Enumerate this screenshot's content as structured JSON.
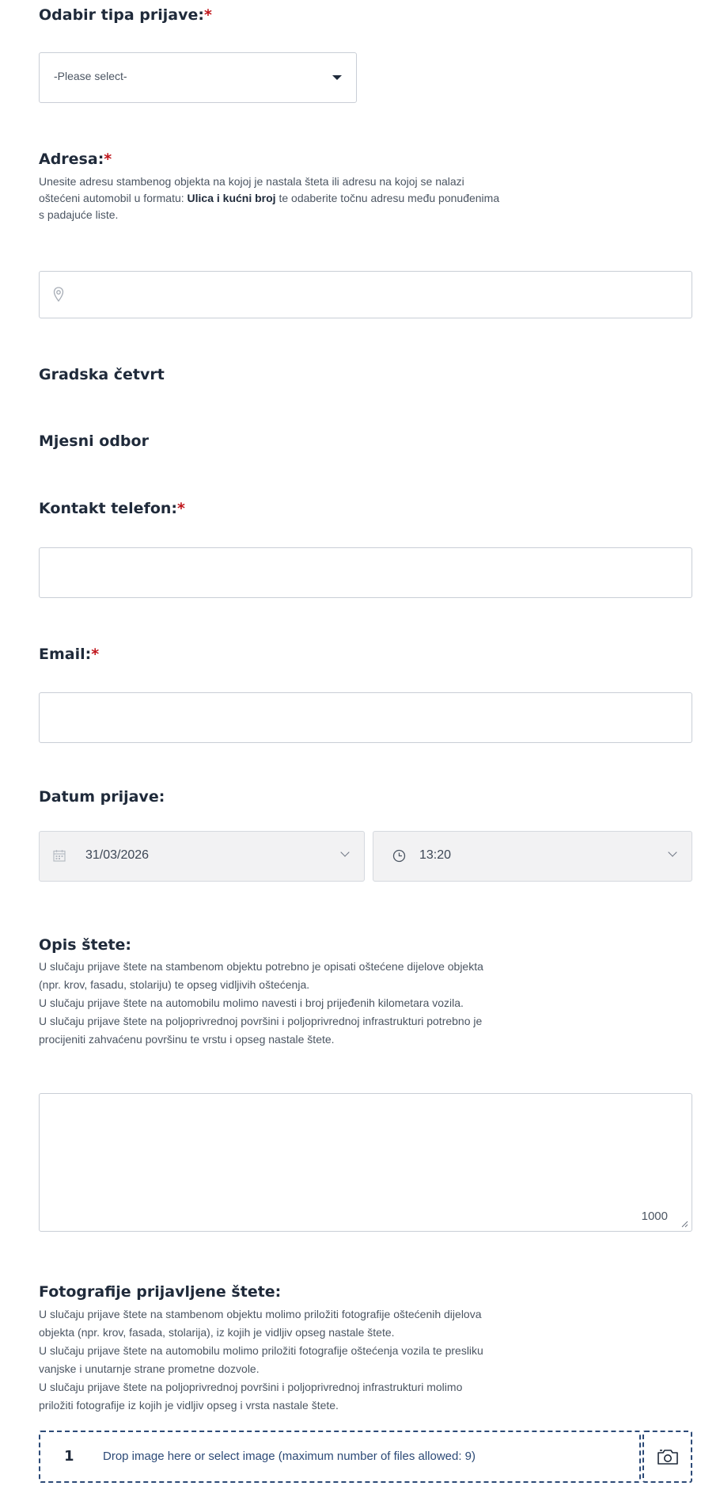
{
  "type_section": {
    "label": "Odabir tipa prijave:",
    "required_mark": "*",
    "select_value": "-Please select-"
  },
  "address_section": {
    "label": "Adresa:",
    "required_mark": "*",
    "help_part1": "Unesite adresu stambenog objekta na kojoj je nastala šteta ili adresu na kojoj se nalazi",
    "help_part2": "oštećeni automobil u formatu: ",
    "help_bold": "Ulica i kućni broj",
    "help_part3": " te odaberite točnu adresu među ponuđenima",
    "help_part4": "s padajuće liste.",
    "input_value": ""
  },
  "district_label": "Gradska četvrt",
  "council_label": "Mjesni odbor",
  "phone_section": {
    "label": "Kontakt telefon:",
    "required_mark": "*",
    "input_value": ""
  },
  "email_section": {
    "label": "Email:",
    "required_mark": "*",
    "input_value": ""
  },
  "date_section": {
    "label": "Datum prijave:",
    "date_value": "31/03/2026",
    "time_value": "13:20"
  },
  "description_section": {
    "label": "Opis štete:",
    "help_lines": [
      "U slučaju prijave štete na stambenom objektu potrebno je opisati oštećene dijelove objekta",
      "(npr. krov, fasadu, stolariju) te opseg vidljivih oštećenja.",
      "U slučaju prijave štete na automobilu molimo navesti i broj prijeđenih kilometara vozila.",
      "U slučaju prijave štete na poljoprivrednoj površini i poljoprivrednoj infrastrukturi potrebno je",
      "procijeniti zahvaćenu površinu te vrstu i opseg nastale štete."
    ],
    "textarea_value": "",
    "char_counter": "1000"
  },
  "photos_section": {
    "label": "Fotografije prijavljene štete:",
    "help_lines": [
      "U slučaju prijave štete na stambenom objektu molimo priložiti fotografije oštećenih dijelova",
      "objekta (npr. krov, fasada, stolarija), iz kojih je vidljiv opseg nastale štete.",
      "U slučaju prijave štete na automobilu molimo priložiti fotografije oštećenja vozila te presliku",
      "vanjske i unutarnje strane prometne dozvole.",
      "U slučaju prijave štete na poljoprivrednoj površini i poljoprivrednoj infrastrukturi molimo",
      "priložiti fotografije iz kojih je vidljiv opseg i vrsta nastale štete."
    ],
    "drop_number": "1",
    "drop_text": "Drop image here or select image (maximum number of files allowed: 9)"
  },
  "icons": {
    "select_caret": "caret-down-icon",
    "address": "location-pin-icon",
    "date": "calendar-icon",
    "time": "clock-icon",
    "dropdown": "chevron-down-icon",
    "resize": "resize-handle-icon",
    "camera": "camera-icon"
  },
  "colors": {
    "required": "#c0161c",
    "text": "#1f2a3a",
    "accent": "#2c4a77",
    "disabled_bg": "#f2f2f3"
  }
}
